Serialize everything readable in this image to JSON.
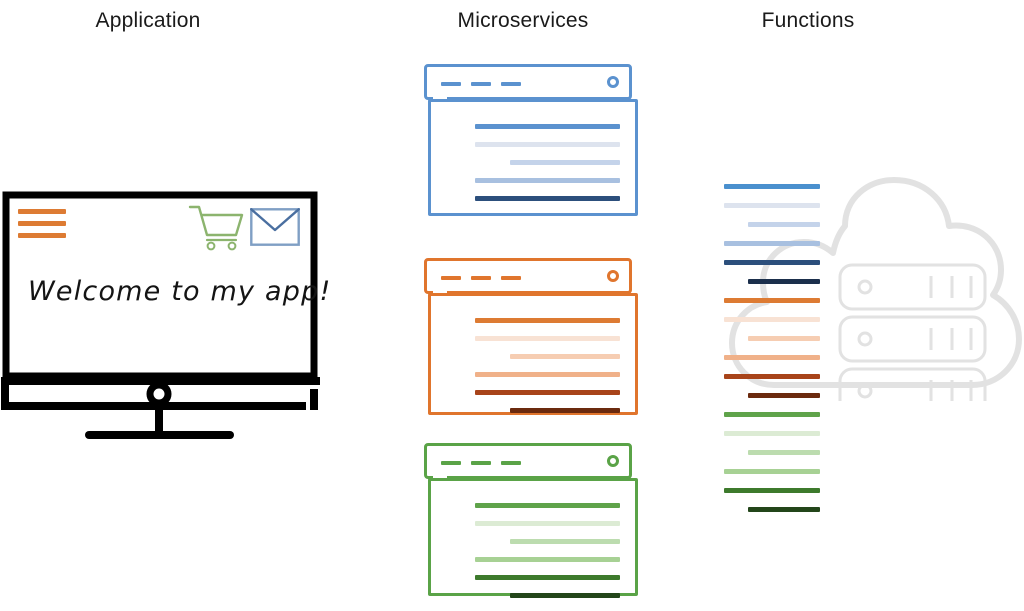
{
  "columns": {
    "application": "Application",
    "microservices": "Microservices",
    "functions": "Functions"
  },
  "application": {
    "screen_text": "Welcome to my app!",
    "icons": [
      {
        "name": "hamburger-menu-icon",
        "color": "#dd7b33"
      },
      {
        "name": "shopping-cart-icon",
        "color": "#8cb46e"
      },
      {
        "name": "envelope-mail-icon",
        "color": "#7f9fc4"
      }
    ],
    "monitor_color": "#000000"
  },
  "microservices": {
    "panels": [
      {
        "id": "blue",
        "accent": "#5b92cf",
        "dash_count": 3,
        "lines": [
          {
            "color": "#5b92cf",
            "width": "full"
          },
          {
            "color": "#dde3ee",
            "width": "full"
          },
          {
            "color": "#c4d3ea",
            "width": "short"
          },
          {
            "color": "#a8c0e0",
            "width": "full"
          },
          {
            "color": "#2c4f7c",
            "width": "full"
          },
          {
            "color": "#1b2f४c",
            "width": "short"
          }
        ]
      },
      {
        "id": "orange",
        "accent": "#e0752d",
        "dash_count": 3,
        "lines": [
          {
            "color": "#dd7b33",
            "width": "full"
          },
          {
            "color": "#f8e2d4",
            "width": "full"
          },
          {
            "color": "#f6cdb2",
            "width": "short"
          },
          {
            "color": "#f0b189",
            "width": "full"
          },
          {
            "color": "#a8441a",
            "width": "full"
          },
          {
            "color": "#6b2a0e",
            "width": "short"
          }
        ]
      },
      {
        "id": "green",
        "accent": "#5aa347",
        "dash_count": 3,
        "lines": [
          {
            "color": "#5fa34a",
            "width": "full"
          },
          {
            "color": "#dcebd4",
            "width": "full"
          },
          {
            "color": "#bcdcaf",
            "width": "short"
          },
          {
            "color": "#a7d194",
            "width": "full"
          },
          {
            "color": "#3d7a2c",
            "width": "full"
          },
          {
            "color": "#23461a",
            "width": "short"
          }
        ]
      }
    ]
  },
  "functions": {
    "groups": [
      {
        "id": "blue-functions",
        "lines": [
          {
            "color": "#4a90ce",
            "width": "full"
          },
          {
            "color": "#dde3ee",
            "width": "full"
          },
          {
            "color": "#c4d3ea",
            "width": "short"
          },
          {
            "color": "#a8c0e0",
            "width": "full"
          },
          {
            "color": "#2c4f7c",
            "width": "full"
          },
          {
            "color": "#1b2f4c",
            "width": "short"
          }
        ]
      },
      {
        "id": "orange-functions",
        "lines": [
          {
            "color": "#dd7b33",
            "width": "full"
          },
          {
            "color": "#f8e2d4",
            "width": "full"
          },
          {
            "color": "#f6cdb2",
            "width": "short"
          },
          {
            "color": "#f0b189",
            "width": "full"
          },
          {
            "color": "#a8441a",
            "width": "full"
          },
          {
            "color": "#6b2a0e",
            "width": "short"
          }
        ]
      },
      {
        "id": "green-functions",
        "lines": [
          {
            "color": "#5fa34a",
            "width": "full"
          },
          {
            "color": "#dcebd4",
            "width": "full"
          },
          {
            "color": "#bcdcaf",
            "width": "short"
          },
          {
            "color": "#a7d194",
            "width": "full"
          },
          {
            "color": "#3d7a2c",
            "width": "full"
          },
          {
            "color": "#23461a",
            "width": "short"
          }
        ]
      }
    ],
    "cloud": {
      "name": "cloud-server-icon",
      "color": "#e2e2e2",
      "server_rack_count": 3
    }
  }
}
